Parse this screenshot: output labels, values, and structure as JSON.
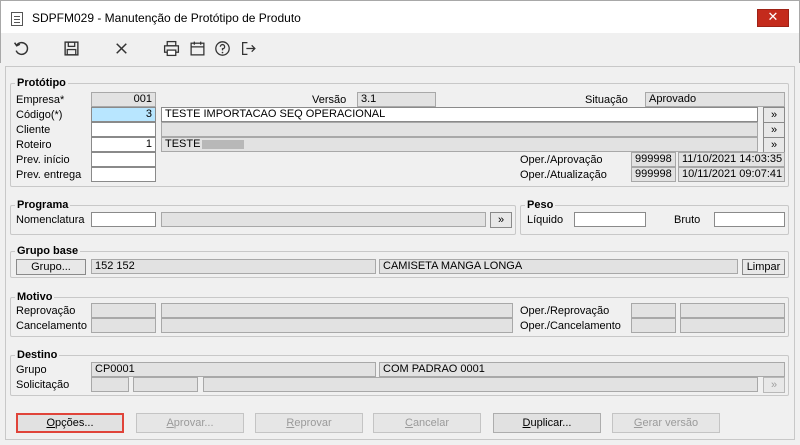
{
  "window": {
    "title": "SDPFM029 - Manutenção de Protótipo de Produto",
    "close_glyph": "✕"
  },
  "toolbar": {
    "icons": [
      "undo-icon",
      "save-icon",
      "close-icon",
      "print-icon",
      "calendar-icon",
      "help-icon",
      "exit-icon"
    ]
  },
  "prototipo": {
    "title": "Protótipo",
    "empresa_label": "Empresa*",
    "empresa_value": "001",
    "versao_label": "Versão",
    "versao_value": "3.1",
    "situacao_label": "Situação",
    "situacao_value": "Aprovado",
    "codigo_label": "Código(*)",
    "codigo_value": "3",
    "codigo_desc": "TESTE IMPORTACAO SEQ OPERACIONAL",
    "cliente_label": "Cliente",
    "roteiro_label": "Roteiro",
    "roteiro_value": "1",
    "roteiro_desc": "TESTE",
    "prev_inicio_label": "Prev. início",
    "prev_entrega_label": "Prev. entrega",
    "oper_aprov_label": "Oper./Aprovação",
    "oper_aprov_user": "999998",
    "oper_aprov_date": "11/10/2021 14:03:35",
    "oper_atual_label": "Oper./Atualização",
    "oper_atual_user": "999998",
    "oper_atual_date": "10/11/2021 09:07:41",
    "lookup_glyph": "»"
  },
  "programa": {
    "title": "Programa",
    "nomenclatura_label": "Nomenclatura",
    "lookup_glyph": "»"
  },
  "peso": {
    "title": "Peso",
    "liquido_label": "Líquido",
    "bruto_label": "Bruto"
  },
  "grupo_base": {
    "title": "Grupo base",
    "grupo_button": "Grupo...",
    "grupo_code": "152 152",
    "grupo_desc": "CAMISETA MANGA LONGA",
    "limpar_button": "Limpar"
  },
  "motivo": {
    "title": "Motivo",
    "reprovacao_label": "Reprovação",
    "cancelamento_label": "Cancelamento",
    "oper_reprov_label": "Oper./Reprovação",
    "oper_cancel_label": "Oper./Cancelamento"
  },
  "destino": {
    "title": "Destino",
    "grupo_label": "Grupo",
    "grupo_code": "CP0001",
    "grupo_desc": "COM PADRAO 0001",
    "solicitacao_label": "Solicitação",
    "lookup_glyph": "»"
  },
  "actions": {
    "opcoes_ul": "O",
    "opcoes_rest": "pções...",
    "aprovar_ul": "A",
    "aprovar_rest": "provar...",
    "reprovar_ul": "R",
    "reprovar_rest": "eprovar",
    "cancelar_ul": "C",
    "cancelar_rest": "ancelar",
    "duplicar_ul": "D",
    "duplicar_rest": "uplicar...",
    "gerar_ul": "G",
    "gerar_rest": "erar versão"
  }
}
